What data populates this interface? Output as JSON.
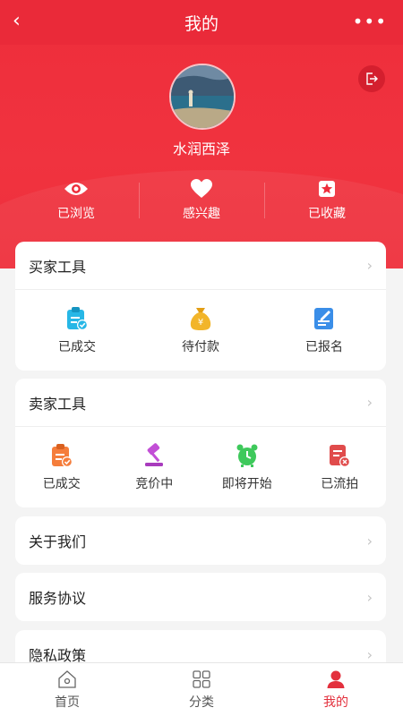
{
  "topbar": {
    "title": "我的",
    "back_icon": "chevron-left-icon",
    "more_icon": "more-dots-icon"
  },
  "profile": {
    "username": "水润西泽",
    "logout_icon": "logout-icon"
  },
  "stats": [
    {
      "label": "已浏览",
      "icon": "eye-icon"
    },
    {
      "label": "感兴趣",
      "icon": "heart-icon"
    },
    {
      "label": "已收藏",
      "icon": "star-icon"
    }
  ],
  "buyer_tools": {
    "title": "买家工具",
    "items": [
      {
        "label": "已成交",
        "icon": "clipboard-check-icon",
        "color": "#27b7e6"
      },
      {
        "label": "待付款",
        "icon": "money-bag-icon",
        "color": "#f2b52a"
      },
      {
        "label": "已报名",
        "icon": "form-edit-icon",
        "color": "#3a8ee8"
      }
    ]
  },
  "seller_tools": {
    "title": "卖家工具",
    "items": [
      {
        "label": "已成交",
        "icon": "clipboard-check-icon",
        "color": "#f57d3b"
      },
      {
        "label": "竞价中",
        "icon": "gavel-icon",
        "color": "#c24fd6"
      },
      {
        "label": "即将开始",
        "icon": "alarm-clock-icon",
        "color": "#3ec95b"
      },
      {
        "label": "已流拍",
        "icon": "document-x-icon",
        "color": "#e04b4b"
      }
    ]
  },
  "menu": [
    {
      "label": "关于我们"
    },
    {
      "label": "服务协议"
    },
    {
      "label": "隐私政策"
    }
  ],
  "tabbar": [
    {
      "label": "首页",
      "icon": "home-icon"
    },
    {
      "label": "分类",
      "icon": "grid-icon"
    },
    {
      "label": "我的",
      "icon": "person-icon",
      "active": true
    }
  ],
  "colors": {
    "brand_red": "#ee2d3b",
    "active_tab": "#e3303d"
  }
}
